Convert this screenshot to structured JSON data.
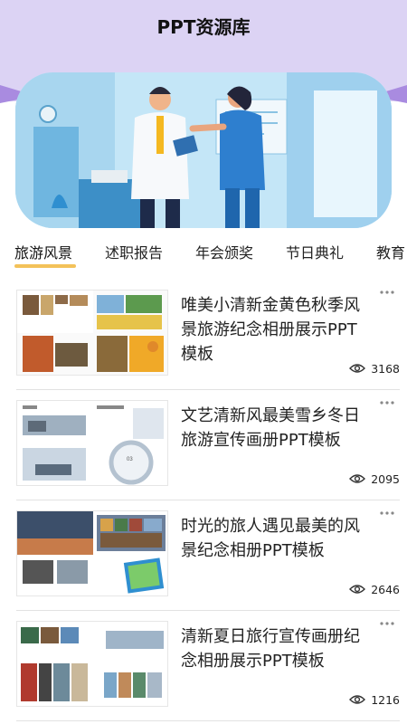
{
  "app": {
    "title": "PPT资源库"
  },
  "banner": {
    "image": "doctor-and-nurse-illustration"
  },
  "tabs": [
    {
      "label": "旅游风景",
      "active": true
    },
    {
      "label": "述职报告",
      "active": false
    },
    {
      "label": "年会颁奖",
      "active": false
    },
    {
      "label": "节日典礼",
      "active": false
    },
    {
      "label": "教育",
      "active": false
    }
  ],
  "items": [
    {
      "title": "唯美小清新金黄色秋季风景旅游纪念相册展示PPT模板",
      "views": "3168",
      "thumb_icon": "autumn-collage"
    },
    {
      "title": "文艺清新风最美雪乡冬日旅游宣传画册PPT模板",
      "views": "2095",
      "thumb_icon": "winter-collage"
    },
    {
      "title": "时光的旅人遇见最美的风景纪念相册PPT模板",
      "views": "2646",
      "thumb_icon": "travel-collage"
    },
    {
      "title": "清新夏日旅行宣传画册纪念相册展示PPT模板",
      "views": "1216",
      "thumb_icon": "summer-collage"
    }
  ],
  "colors": {
    "header_bg": "#dcd3f4",
    "wave": "#a98be0",
    "tab_underline": "#f3c25a",
    "text": "#222222"
  },
  "icons": {
    "more": "more-dots-icon",
    "views": "eye-icon"
  }
}
